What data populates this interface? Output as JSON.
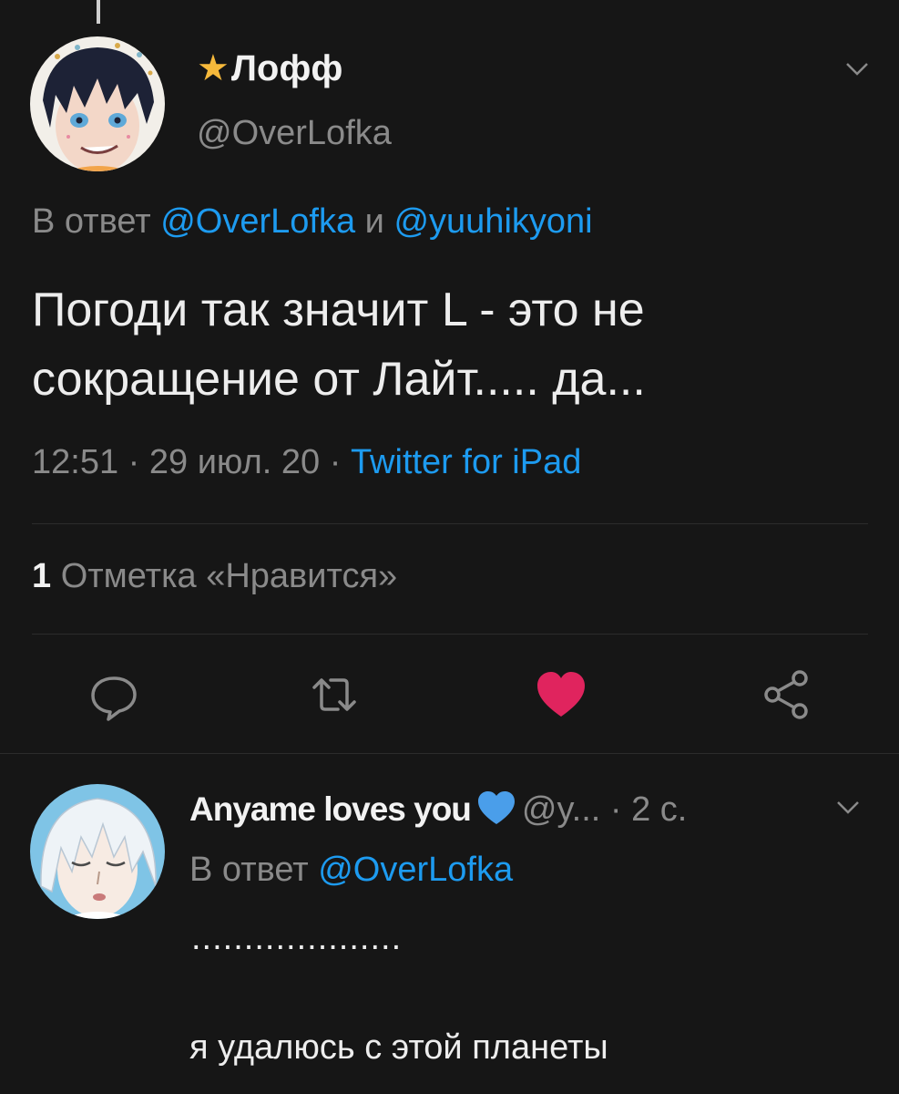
{
  "main_tweet": {
    "display_name": "Лофф",
    "name_emoji": "star-icon",
    "handle": "@OverLofka",
    "reply_prefix": "В ответ",
    "reply_mention_1": "@OverLofka",
    "reply_conjunction": "и",
    "reply_mention_2": "@yuuhikyoni",
    "text_line_1": "Погоди так значит L - это не",
    "text_line_2": "сокращение от Лайт..... да...",
    "time": "12:51",
    "separator": "·",
    "date": "29 июл. 20",
    "source": "Twitter for iPad",
    "like_count": "1",
    "like_label": "Отметка «Нравится»",
    "liked": true
  },
  "actions": {
    "reply_icon": "comment-icon",
    "retweet_icon": "retweet-icon",
    "like_icon": "heart-icon",
    "share_icon": "share-icon",
    "like_color": "#e0245e"
  },
  "reply_tweet": {
    "display_name": "Anyame loves you",
    "name_emoji": "blue-heart-icon",
    "handle": "@y...",
    "time_ago": "· 2 с.",
    "reply_prefix": "В ответ",
    "reply_mention": "@OverLofka",
    "text_dots": "....................",
    "text": "я удалюсь с этой планеты"
  },
  "colors": {
    "background": "#161616",
    "link": "#1d9bf0",
    "secondary_text": "#8a8a8a",
    "star": "#f6b93b",
    "blue_heart": "#4a9eea"
  }
}
